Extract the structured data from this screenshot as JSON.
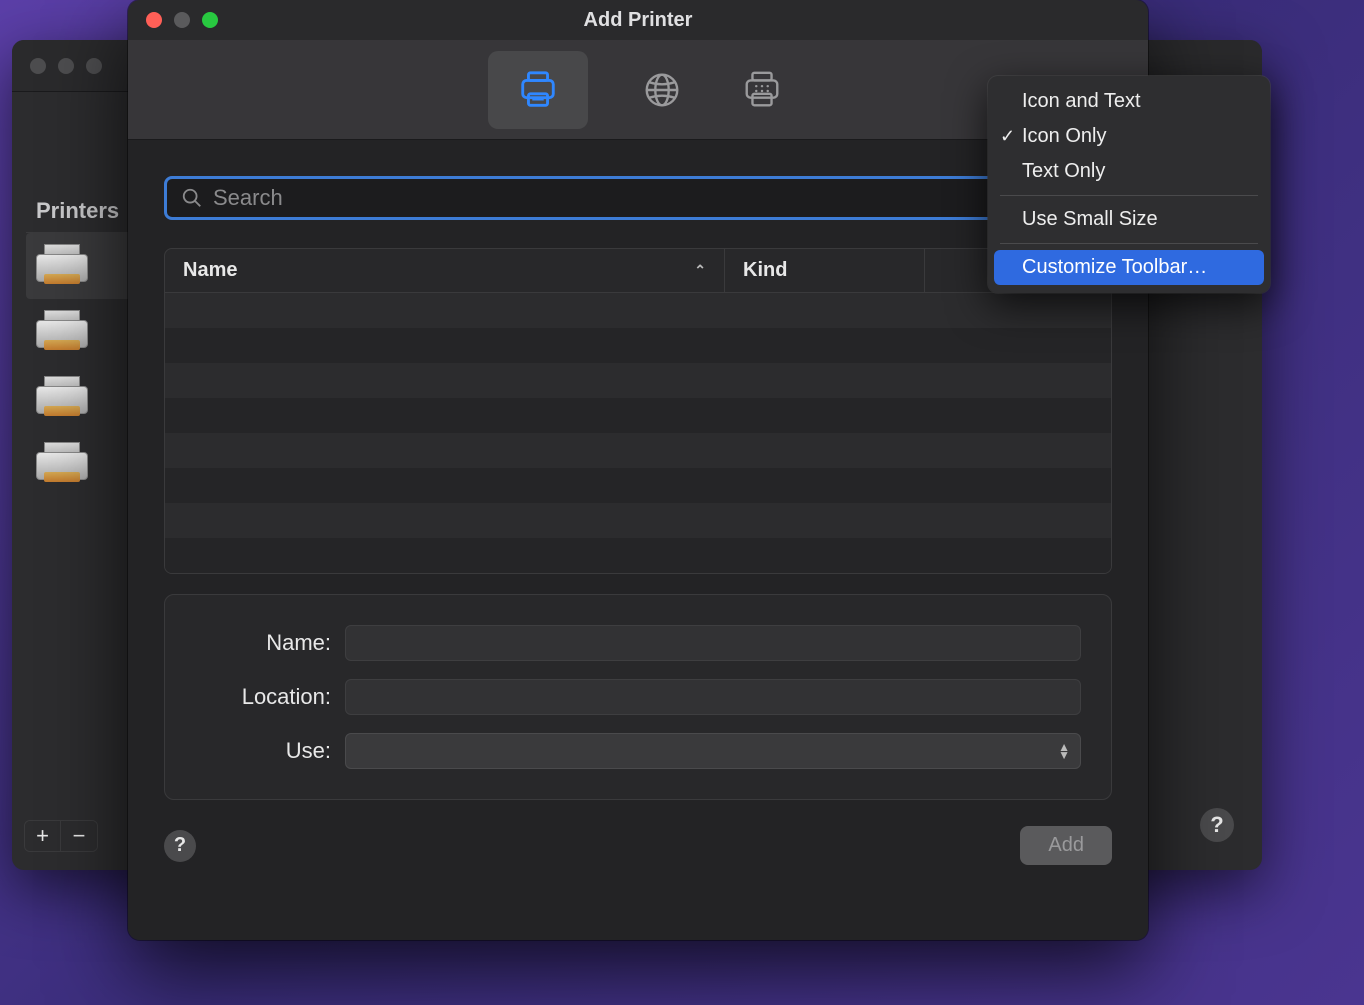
{
  "bg_window": {
    "sidebar_label": "Printers",
    "printers": [
      1,
      2,
      3,
      4
    ],
    "add_label": "+",
    "remove_label": "−",
    "help_label": "?"
  },
  "fg_window": {
    "title": "Add Printer",
    "toolbar": {
      "default_name": "default-tab",
      "ip_name": "ip-tab",
      "windows_name": "windows-tab"
    },
    "search": {
      "placeholder": "Search"
    },
    "table": {
      "col_name": "Name",
      "col_kind": "Kind",
      "rows": [
        1,
        2,
        3,
        4,
        5,
        6,
        7,
        8
      ]
    },
    "form": {
      "name_label": "Name:",
      "location_label": "Location:",
      "use_label": "Use:"
    },
    "help_label": "?",
    "add_button": "Add"
  },
  "context_menu": {
    "icon_and_text": "Icon and Text",
    "icon_only": "Icon Only",
    "text_only": "Text Only",
    "use_small_size": "Use Small Size",
    "customize": "Customize Toolbar…"
  }
}
